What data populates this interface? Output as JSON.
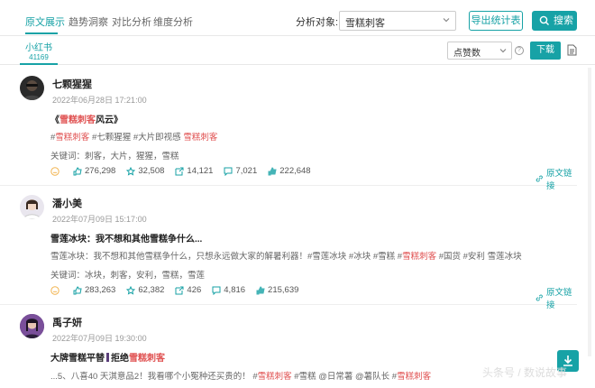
{
  "tabs": [
    {
      "label": "原文展示",
      "active": true
    },
    {
      "label": "趋势洞察",
      "active": false
    },
    {
      "label": "对比分析",
      "active": false
    },
    {
      "label": "维度分析",
      "active": false
    }
  ],
  "analyze": {
    "label": "分析对象:",
    "value": "雪糕刺客"
  },
  "buttons": {
    "export": "导出统计表",
    "search": "搜索",
    "download": "下载"
  },
  "platform": {
    "name": "小红书",
    "count": "41169"
  },
  "sort": {
    "value": "点赞数"
  },
  "colors": {
    "accent": "#17a2a6",
    "highlight": "#e05252"
  },
  "posts": [
    {
      "author": "七颗猩猩",
      "time": "2022年06月28日 17:21:00",
      "title_pre": "《",
      "title_hl": "雪糕刺客",
      "title_post": "风云》",
      "body_pre": "#",
      "body_hl1": "雪糕刺客",
      "body_mid": " #七颗猩猩 #大片即视感 ",
      "body_hl2": "雪糕刺客",
      "body_post": "",
      "keywords": "关键词：刺客，大片，猩猩，雪糕",
      "stats": {
        "likes": "276,298",
        "collects": "32,508",
        "shares": "14,121",
        "comments": "7,021",
        "thumbs": "222,648"
      },
      "link": "原文链接"
    },
    {
      "author": "潘小美",
      "time": "2022年07月09日 15:17:00",
      "title_pre": "雪莲冰块：我不想和其他雪糕争什么...",
      "title_hl": "",
      "title_post": "",
      "body_pre": "雪莲冰块：我不想和其他雪糕争什么，只想永远做大家的解暑利器！#雪莲冰块 #冰块 #雪糕 #",
      "body_hl1": "雪糕刺客",
      "body_mid": " #国货 #安利 雪莲冰块",
      "body_hl2": "",
      "body_post": "",
      "keywords": "关键词：冰块，刺客，安利，雪糕，雪莲",
      "stats": {
        "likes": "283,263",
        "collects": "62,382",
        "shares": "426",
        "comments": "4,816",
        "thumbs": "215,639"
      },
      "link": "原文链接"
    },
    {
      "author": "禹子妍",
      "time": "2022年07月09日 19:30:00",
      "title_pre": "大牌雪糕平替",
      "title_hl": "",
      "title_post": "拒绝",
      "title_hl2": "雪糕刺客",
      "body_pre": "...5、八喜40 天淇意品2！我看哪个小冤种还买贵的！ #",
      "body_hl1": "雪糕刺客",
      "body_mid": " #雪糕 @日常薯 @薯队长 #",
      "body_hl2": "雪糕刺客",
      "body_post": ""
    }
  ],
  "watermark": "头条号 / 数说故事"
}
